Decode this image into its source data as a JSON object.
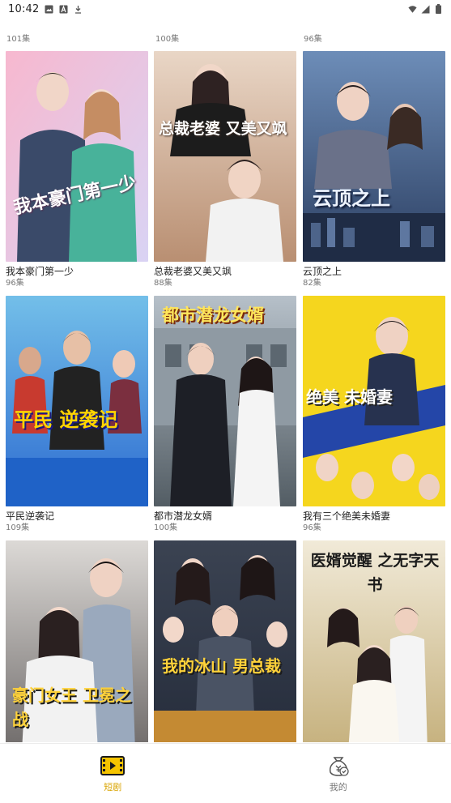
{
  "status_bar": {
    "time": "10:42",
    "left_icons": [
      "image-icon",
      "a-icon",
      "download-icon"
    ],
    "right_icons": [
      "wifi-icon",
      "signal-icon",
      "battery-icon"
    ]
  },
  "top_row_counts": [
    "101集",
    "100集",
    "96集"
  ],
  "dramas": [
    {
      "title": "我本豪门第一少",
      "episodes": "96集",
      "poster_text": "我本豪门第一少",
      "colors": [
        "#f7b8cf",
        "#d9d3f4"
      ]
    },
    {
      "title": "总裁老婆又美又飒",
      "episodes": "88集",
      "poster_text": "总裁老婆 又美又飒",
      "colors": [
        "#e9d6c6",
        "#b98f72"
      ]
    },
    {
      "title": "云顶之上",
      "episodes": "82集",
      "poster_text": "云顶之上",
      "colors": [
        "#6d8db8",
        "#2c3f62"
      ]
    },
    {
      "title": "平民逆袭记",
      "episodes": "109集",
      "poster_text": "平民 逆袭记",
      "colors": [
        "#73bfe9",
        "#2d6bd0"
      ]
    },
    {
      "title": "都市潜龙女婿",
      "episodes": "100集",
      "poster_text": "都市潜龙女婿",
      "colors": [
        "#b6c0c9",
        "#535d64"
      ]
    },
    {
      "title": "我有三个绝美未婚妻",
      "episodes": "96集",
      "poster_text": "绝美 未婚妻",
      "colors": [
        "#f5d61e",
        "#2446a8"
      ]
    },
    {
      "title": "豪门女王",
      "episodes": "",
      "poster_text": "豪门女王 卫冕之战",
      "colors": [
        "#dcd9d6",
        "#6f6b6a"
      ]
    },
    {
      "title": "我的冰山男总裁",
      "episodes": "",
      "poster_text": "我的冰山 男总裁",
      "colors": [
        "#252c3b",
        "#c48a33"
      ]
    },
    {
      "title": "医婿觉醒",
      "episodes": "",
      "poster_text": "医婿觉醒 之无字天书",
      "colors": [
        "#f1ead8",
        "#c5b07c"
      ]
    }
  ],
  "bottom_nav": {
    "items": [
      {
        "label": "短剧",
        "icon": "film-icon",
        "active": true
      },
      {
        "label": "我的",
        "icon": "money-bag-icon",
        "active": false
      }
    ],
    "active_color": "#d9a400",
    "inactive_color": "#777777"
  }
}
